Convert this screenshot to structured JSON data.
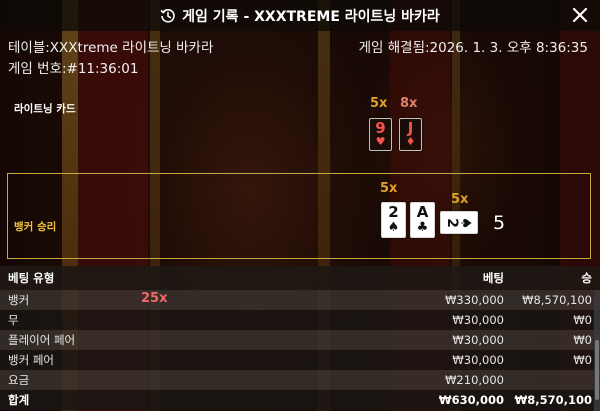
{
  "header": {
    "title": "게임 기록 - XXXTREME 라이트닝 바카라"
  },
  "info": {
    "table": "테이블:XXXtreme 라이트닝 바카라",
    "game_number": "게임 번호:#11:36:01",
    "resolved": "게임 해결됨:2026. 1. 3. 오후 8:36:35"
  },
  "lightning": {
    "label": "라이트닝 카드",
    "cards": [
      {
        "multiplier": "5x",
        "rank": "9",
        "suit": "♥",
        "color": "#f3544c"
      },
      {
        "multiplier": "8x",
        "rank": "J",
        "suit": "♦",
        "color": "#f3544c"
      }
    ]
  },
  "result": {
    "label": "뱅커 승리",
    "cards": [
      {
        "rank": "2",
        "suit": "♠",
        "multiplier": "5x"
      },
      {
        "rank": "A",
        "suit": "♣",
        "multiplier": ""
      },
      {
        "rank": "2",
        "suit": "♠",
        "multiplier": "5x",
        "sideways": true
      }
    ],
    "score": "5",
    "accent_color": "#f0c040"
  },
  "bets": {
    "headers": {
      "type": "베팅 유형",
      "bet": "베팅",
      "win": "승"
    },
    "rows": [
      {
        "type": "뱅커",
        "multiplier": "25x",
        "bet": "₩330,000",
        "win": "₩8,570,100"
      },
      {
        "type": "무",
        "multiplier": "",
        "bet": "₩30,000",
        "win": "₩0"
      },
      {
        "type": "플레이어 페어",
        "multiplier": "",
        "bet": "₩30,000",
        "win": "₩0"
      },
      {
        "type": "뱅커 페어",
        "multiplier": "",
        "bet": "₩30,000",
        "win": "₩0"
      },
      {
        "type": "요금",
        "multiplier": "",
        "bet": "₩210,000",
        "win": ""
      }
    ],
    "total": {
      "type": "합계",
      "bet": "₩630,000",
      "win": "₩8,570,100"
    }
  },
  "colors": {
    "multiplier_gold": "#e0a126",
    "multiplier_red": "#f06a6a",
    "card_red": "#f3544c"
  }
}
